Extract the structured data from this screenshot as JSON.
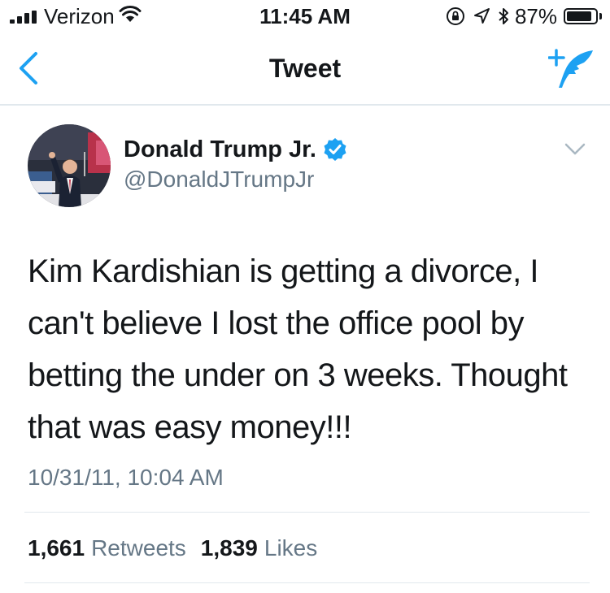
{
  "status_bar": {
    "carrier": "Verizon",
    "time": "11:45 AM",
    "battery_percent": "87%",
    "battery_level": 0.87,
    "signal_bars": 4,
    "icons": [
      "signal-icon",
      "wifi-icon",
      "orientation-lock-icon",
      "location-icon",
      "bluetooth-icon",
      "battery-icon"
    ]
  },
  "nav": {
    "title": "Tweet",
    "back_icon": "back-chevron-icon",
    "compose_icon": "compose-tweet-icon"
  },
  "tweet": {
    "author": {
      "name": "Donald Trump Jr.",
      "handle": "@DonaldJTrumpJr",
      "verified": true
    },
    "text": "Kim Kardishian is getting a divorce, I can't believe I lost the office pool by betting the under on 3 weeks. Thought that was easy money!!!",
    "timestamp": "10/31/11, 10:04 AM",
    "stats": {
      "retweets_count": "1,661",
      "retweets_label": "Retweets",
      "likes_count": "1,839",
      "likes_label": "Likes"
    }
  },
  "colors": {
    "accent": "#1da1f2",
    "text_primary": "#14171a",
    "text_secondary": "#657786",
    "divider": "#e1e8ed"
  }
}
